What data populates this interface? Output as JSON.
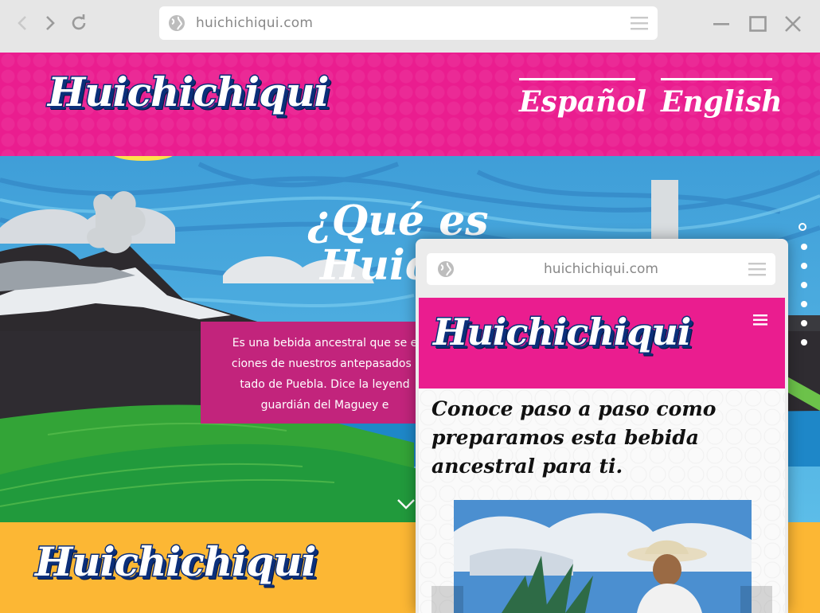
{
  "browser": {
    "url": "huichichiqui.com",
    "icons": {
      "back": "chevron-left-icon",
      "forward": "chevron-right-icon",
      "reload": "reload-icon",
      "site": "globe-icon",
      "menu": "menu-icon",
      "minimize": "minimize-icon",
      "maximize": "maximize-icon",
      "close": "close-icon"
    }
  },
  "site": {
    "logo": "Huichichiqui",
    "languages": [
      "Español",
      "English"
    ],
    "hero": {
      "title_line1": "¿Qué es",
      "title_line2": "Huichi",
      "paragraph": [
        "Es una bebida ancestral que se e",
        "ciones de nuestros antepasados l",
        "tado de Puebla. Dice la leyend",
        "guardián del Maguey e"
      ]
    },
    "footer_logo": "Huichichiqui"
  },
  "mobile": {
    "url": "huichichiqui.com",
    "logo": "Huichichiqui",
    "heading": "Conoce paso a paso como preparamos esta bebida ancestral para ti."
  },
  "colors": {
    "brand_pink": "#ea1d8f",
    "box_magenta": "#c2247c",
    "footer_yellow": "#fcb734",
    "logo_navy": "#0b2f7a",
    "sky_blue": "#4fb3e3"
  }
}
